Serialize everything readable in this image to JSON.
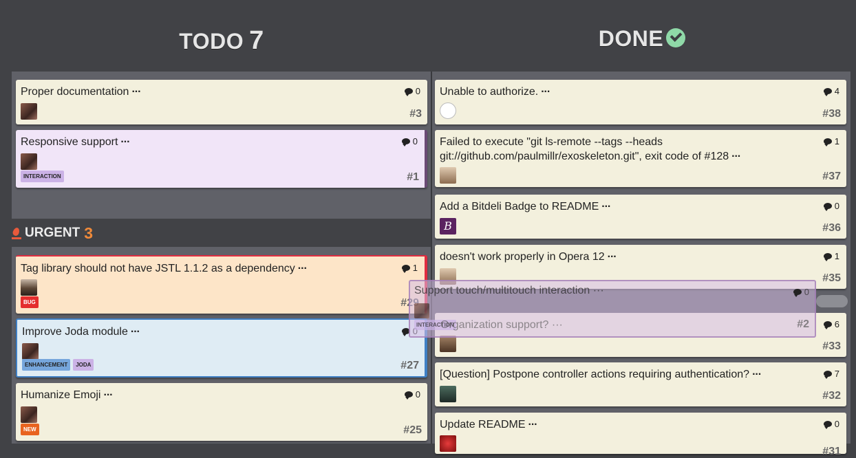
{
  "columns": {
    "todo": {
      "title": "TODO",
      "count": "7"
    },
    "done": {
      "title": "DONE"
    }
  },
  "urgent": {
    "title": "URGENT",
    "count": "3"
  },
  "todo_cards": [
    {
      "title": "Proper documentation",
      "more": "···",
      "comments": "0",
      "number": "#3"
    },
    {
      "title": "Responsive support",
      "more": "···",
      "comments": "0",
      "number": "#1",
      "labels": [
        "INTERACTION"
      ]
    }
  ],
  "urgent_cards": [
    {
      "title": "Tag library should not have JSTL 1.1.2 as a dependency",
      "more": "···",
      "comments": "1",
      "number": "#29",
      "labels": [
        "BUG"
      ]
    },
    {
      "title": "Improve Joda module",
      "more": "···",
      "comments": "0",
      "number": "#27",
      "labels": [
        "ENHANCEMENT",
        "JODA"
      ]
    },
    {
      "title": "Humanize Emoji",
      "more": "···",
      "comments": "0",
      "number": "#25",
      "labels": [
        "NEW"
      ]
    }
  ],
  "done_cards": [
    {
      "title": "Unable to authorize.",
      "more": "···",
      "comments": "4",
      "number": "#38"
    },
    {
      "title": "Failed to execute \"git ls-remote --tags --heads git://github.com/paulmillr/exoskeleton.git\", exit code of #128",
      "more": "···",
      "comments": "1",
      "number": "#37"
    },
    {
      "title": "Add a Bitdeli Badge to README",
      "more": "···",
      "comments": "0",
      "number": "#36",
      "avatar_letter": "B"
    },
    {
      "title": "doesn't work properly in Opera 12",
      "more": "···",
      "comments": "1",
      "number": "#35"
    },
    {
      "title": "",
      "comments": "6",
      "number": "#33"
    },
    {
      "title": "[Question] Postpone controller actions requiring authentication?",
      "more": "···",
      "comments": "7",
      "number": "#32"
    },
    {
      "title": "Update README",
      "more": "···",
      "comments": "0",
      "number": "#31"
    }
  ],
  "drag_ghost": {
    "title": "Support touch/multitouch interaction ···",
    "comments": "0",
    "second_title": "Organization support? ···",
    "number": "#2",
    "label": "INTERACTION"
  }
}
